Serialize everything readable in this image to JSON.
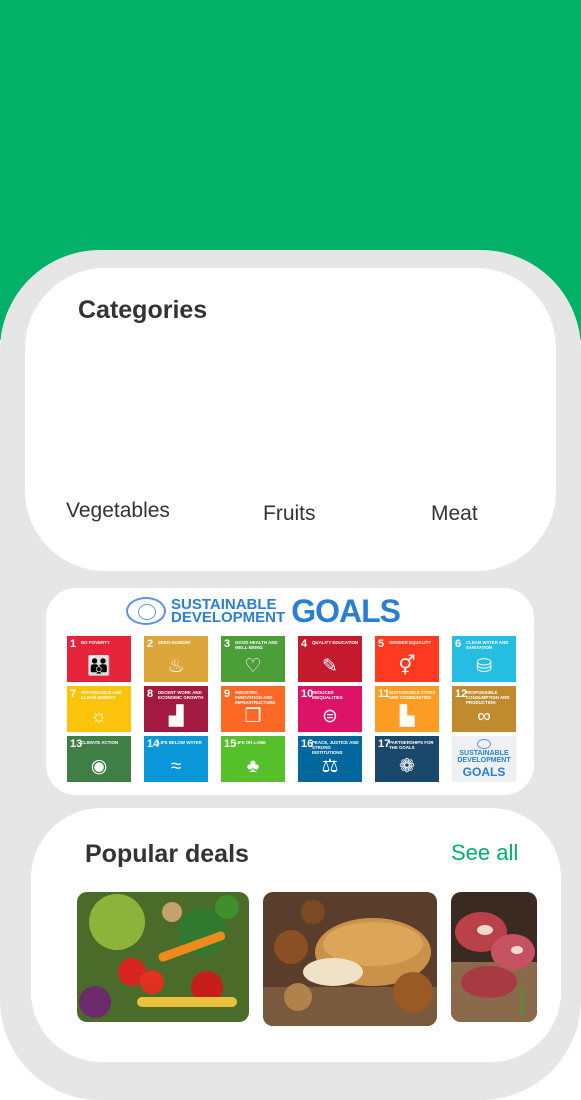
{
  "categories": {
    "title": "Categories",
    "items": [
      "Vegetables",
      "Fruits",
      "Meat"
    ]
  },
  "sdg_banner": {
    "header_line1": "SUSTAINABLE",
    "header_line2": "DEVELOPMENT",
    "header_big": "GOALS",
    "goals": [
      {
        "num": "1",
        "name": "No Poverty",
        "color": "#e5243b",
        "icon": "family-icon",
        "glyph": "👪"
      },
      {
        "num": "2",
        "name": "Zero Hunger",
        "color": "#dda63a",
        "icon": "bowl-icon",
        "glyph": "♨"
      },
      {
        "num": "3",
        "name": "Good Health and Well-Being",
        "color": "#4c9f38",
        "icon": "heartbeat-icon",
        "glyph": "♡"
      },
      {
        "num": "4",
        "name": "Quality Education",
        "color": "#c5192d",
        "icon": "book-icon",
        "glyph": "✎"
      },
      {
        "num": "5",
        "name": "Gender Equality",
        "color": "#ff3a21",
        "icon": "gender-icon",
        "glyph": "⚥"
      },
      {
        "num": "6",
        "name": "Clean Water and Sanitation",
        "color": "#26bde2",
        "icon": "water-drop-icon",
        "glyph": "⛁"
      },
      {
        "num": "7",
        "name": "Affordable and Clean Energy",
        "color": "#fcc30b",
        "icon": "sun-icon",
        "glyph": "☼"
      },
      {
        "num": "8",
        "name": "Decent Work and Economic Growth",
        "color": "#a21942",
        "icon": "growth-chart-icon",
        "glyph": "▟"
      },
      {
        "num": "9",
        "name": "Industry, Innovation and Infrastructure",
        "color": "#fd6925",
        "icon": "cubes-icon",
        "glyph": "❒"
      },
      {
        "num": "10",
        "name": "Reduced Inequalities",
        "color": "#dd1367",
        "icon": "equals-icon",
        "glyph": "⊜"
      },
      {
        "num": "11",
        "name": "Sustainable Cities and Communities",
        "color": "#fd9d24",
        "icon": "city-icon",
        "glyph": "▙"
      },
      {
        "num": "12",
        "name": "Responsible Consumption and Production",
        "color": "#bf8b2e",
        "icon": "infinity-icon",
        "glyph": "∞"
      },
      {
        "num": "13",
        "name": "Climate Action",
        "color": "#3f7e44",
        "icon": "eye-globe-icon",
        "glyph": "◉"
      },
      {
        "num": "14",
        "name": "Life Below Water",
        "color": "#0a97d9",
        "icon": "fish-icon",
        "glyph": "≈"
      },
      {
        "num": "15",
        "name": "Life on Land",
        "color": "#56c02b",
        "icon": "tree-icon",
        "glyph": "♣"
      },
      {
        "num": "16",
        "name": "Peace, Justice and Strong Institutions",
        "color": "#00689d",
        "icon": "dove-icon",
        "glyph": "⚖"
      },
      {
        "num": "17",
        "name": "Partnerships for the Goals",
        "color": "#19486a",
        "icon": "rings-icon",
        "glyph": "❁"
      }
    ],
    "logo_tile": {
      "line1": "SUSTAINABLE",
      "line2": "DEVELOPMENT",
      "big": "GOALS"
    }
  },
  "popular_deals": {
    "title": "Popular deals",
    "see_all": "See all",
    "items": [
      {
        "image": "vegetables-image"
      },
      {
        "image": "bread-image"
      },
      {
        "image": "meat-image"
      }
    ]
  },
  "colors": {
    "brand_green": "#00b167",
    "panel_gray": "#e6e6e6",
    "text_dark": "#333333"
  }
}
